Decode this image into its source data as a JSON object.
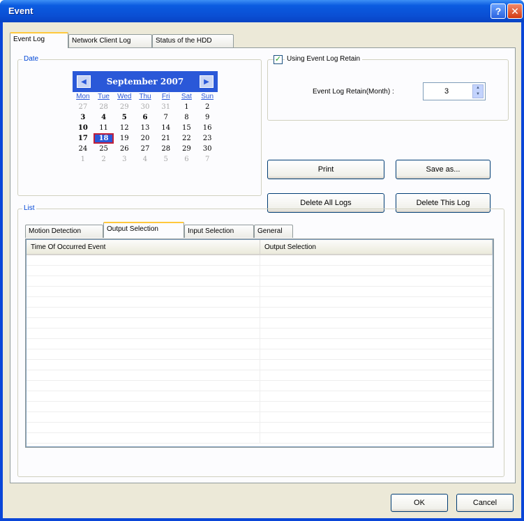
{
  "window": {
    "title": "Event",
    "help_glyph": "?",
    "close_glyph": "✕"
  },
  "tabs": [
    {
      "label": "Event Log",
      "active": true
    },
    {
      "label": "Network Client Log",
      "active": false
    },
    {
      "label": "Status of the HDD",
      "active": false
    }
  ],
  "date_group": {
    "label": "Date",
    "calendar": {
      "month_year": "September 2007",
      "prev_glyph": "◀",
      "next_glyph": "▶",
      "weekdays": [
        "Mon",
        "Tue",
        "Wed",
        "Thu",
        "Fri",
        "Sat",
        "Sun"
      ],
      "weeks": [
        [
          "27",
          "28",
          "29",
          "30",
          "31",
          "1",
          "2"
        ],
        [
          "3",
          "4",
          "5",
          "6",
          "7",
          "8",
          "9"
        ],
        [
          "10",
          "11",
          "12",
          "13",
          "14",
          "15",
          "16"
        ],
        [
          "17",
          "18",
          "19",
          "20",
          "21",
          "22",
          "23"
        ],
        [
          "24",
          "25",
          "26",
          "27",
          "28",
          "29",
          "30"
        ],
        [
          "1",
          "2",
          "3",
          "4",
          "5",
          "6",
          "7"
        ]
      ],
      "selected_day": "18"
    }
  },
  "retain": {
    "checkbox_label": "Using Event Log Retain",
    "checked": true,
    "field_label": "Event Log Retain(Month) :",
    "field_value": "3"
  },
  "buttons": {
    "print": "Print",
    "save_as": "Save as...",
    "delete_all": "Delete All Logs",
    "delete_this": "Delete This Log",
    "ok": "OK",
    "cancel": "Cancel"
  },
  "list_group": {
    "label": "List",
    "subtabs": [
      {
        "label": "Motion Detection",
        "active": false
      },
      {
        "label": "Output Selection",
        "active": true
      },
      {
        "label": "Input Selection",
        "active": false
      },
      {
        "label": "General",
        "active": false
      }
    ],
    "columns": [
      "Time Of Occurred Event",
      "Output Selection"
    ],
    "rows": []
  },
  "colors": {
    "titlebar": "#0a4fd4",
    "accent": "#2a58d8",
    "face": "#ece9d8"
  }
}
